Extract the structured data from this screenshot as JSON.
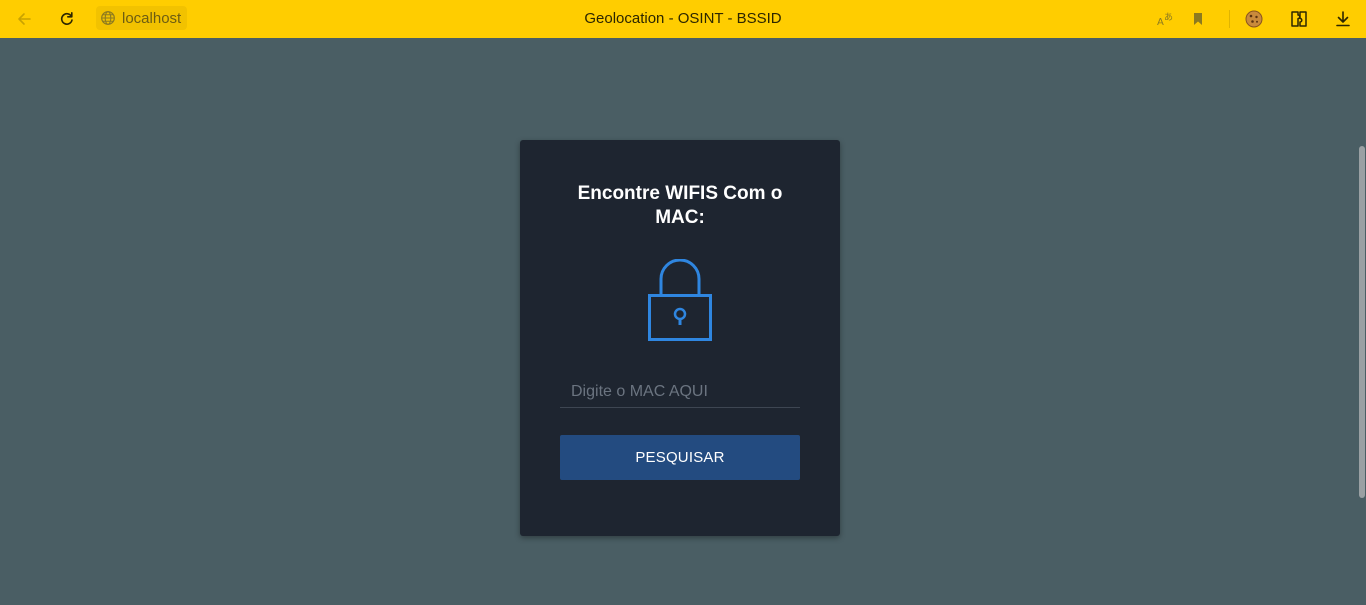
{
  "browser": {
    "url": "localhost",
    "title": "Geolocation - OSINT - BSSID",
    "icons": [
      "back-arrow-icon",
      "reload-icon",
      "globe-icon",
      "translate-icon",
      "bookmark-icon",
      "cookie-icon",
      "extensions-icon",
      "download-icon"
    ]
  },
  "card": {
    "title": "Encontre WIFIS Com o MAC:",
    "input_placeholder": "Digite o MAC AQUI",
    "button_label": "PESQUISAR"
  },
  "colors": {
    "browser_bar": "#ffcd00",
    "page_background": "#4a5e64",
    "card_background": "#1e2530",
    "lock_accent": "#2f86e0",
    "button": "#234b80"
  }
}
